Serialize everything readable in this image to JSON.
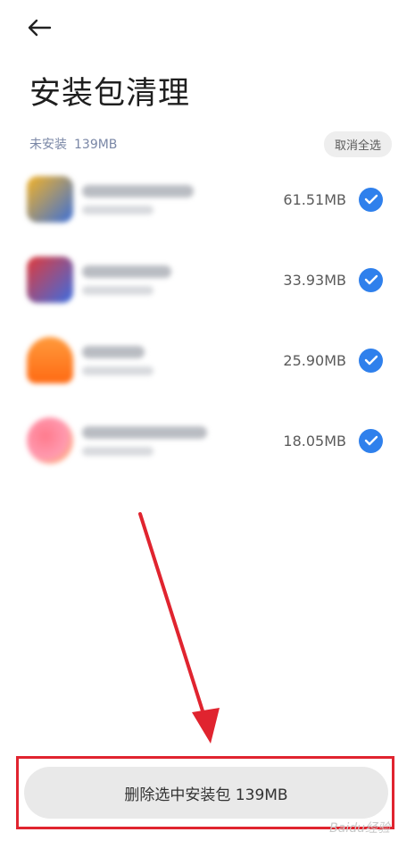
{
  "header": {
    "title": "安装包清理",
    "back_icon": "arrow-left-icon"
  },
  "section": {
    "label": "未安装",
    "size": "139MB",
    "deselect_label": "取消全选"
  },
  "apps": [
    {
      "size": "61.51MB",
      "checked": true,
      "icon_colors": [
        "#f4b326",
        "#3b6fd8"
      ]
    },
    {
      "size": "33.93MB",
      "checked": true,
      "icon_colors": [
        "#e23a3a",
        "#3a6de2"
      ]
    },
    {
      "size": "25.90MB",
      "checked": true,
      "icon_colors": [
        "#ff6a13",
        "#ff9a3c"
      ]
    },
    {
      "size": "18.05MB",
      "checked": true,
      "icon_colors": [
        "#ff7a8c",
        "#ffc34d"
      ]
    }
  ],
  "footer": {
    "delete_label": "删除选中安装包 139MB"
  },
  "annotation": {
    "color": "#e0242f"
  },
  "watermark": {
    "text": "Baidu经验"
  },
  "colors": {
    "accent": "#2f80ec",
    "annotation_red": "#e0242f"
  }
}
